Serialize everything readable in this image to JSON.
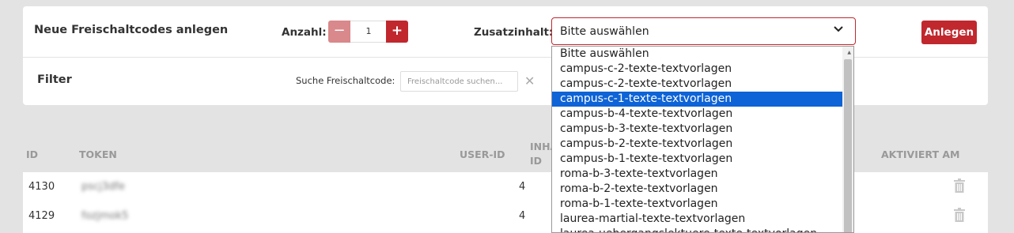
{
  "create": {
    "title": "Neue Freischaltcodes anlegen",
    "anzahl_label": "Anzahl:",
    "minus": "−",
    "qty_value": "1",
    "plus": "+",
    "zusatz_label": "Zusatzinhalt:",
    "select_value": "Bitte auswählen",
    "anlegen_label": "Anlegen"
  },
  "filter": {
    "title": "Filter",
    "search_label": "Suche Freischaltcode:",
    "search_placeholder": "Freischaltcode suchen...",
    "clear_symbol": "✕"
  },
  "table": {
    "headers": [
      "ID",
      "TOKEN",
      "USER-ID",
      "INHA",
      "ID",
      "AKTIVIERT AM"
    ],
    "rows": [
      {
        "id": "4130",
        "token": "pscj3dfe",
        "user_id": "4"
      },
      {
        "id": "4129",
        "token": "fozjmok5",
        "user_id": "4"
      }
    ]
  },
  "dropdown": {
    "options": [
      "Bitte auswählen",
      "campus-c-2-texte-textvorlagen",
      "campus-c-2-texte-textvorlagen",
      "campus-c-1-texte-textvorlagen",
      "campus-b-4-texte-textvorlagen",
      "campus-b-3-texte-textvorlagen",
      "campus-b-2-texte-textvorlagen",
      "campus-b-1-texte-textvorlagen",
      "roma-b-3-texte-textvorlagen",
      "roma-b-2-texte-textvorlagen",
      "roma-b-1-texte-textvorlagen",
      "laurea-martial-texte-textvorlagen",
      "laurea-uebergangslektuere-texte-textvorlagen"
    ],
    "highlighted_index": 3
  },
  "colors": {
    "accent": "#c0282e",
    "accent_light": "#d9888b",
    "highlight": "#0e63d6"
  }
}
